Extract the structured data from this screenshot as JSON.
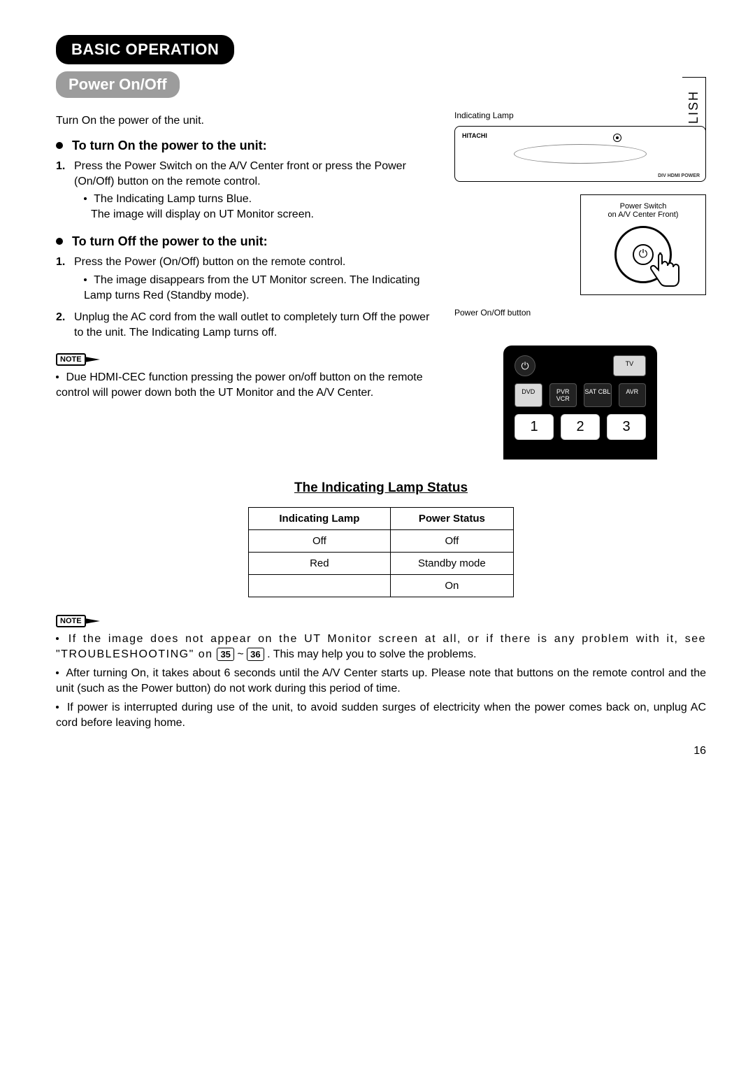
{
  "language_tab": "ENGLISH",
  "section_title": "BASIC OPERATION",
  "subsection_title": "Power On/Off",
  "intro": "Turn On the power of the unit.",
  "turn_on": {
    "heading": "To turn On the power to the unit:",
    "step1_num": "1.",
    "step1": "Press the Power Switch on the A/V Center front or press the Power (On/Off) button on the remote control.",
    "step1_sub_a": "The Indicating Lamp turns Blue.",
    "step1_sub_b": "The image will display on UT Monitor screen."
  },
  "turn_off": {
    "heading": "To turn Off the power to the unit:",
    "step1_num": "1.",
    "step1": "Press the Power (On/Off) button on the remote control.",
    "step1_sub": "The image disappears from the UT Monitor screen. The Indicating Lamp turns Red (Standby mode).",
    "step2_num": "2.",
    "step2": "Unplug the AC cord from the wall outlet to completely turn Off the power to the unit. The Indicating Lamp turns off."
  },
  "note1": {
    "tag": "NOTE",
    "text": "Due HDMI-CEC function pressing the power on/off button on the remote control will power down both the UT Monitor and the A/V Center."
  },
  "diagram": {
    "indicating_lamp_label": "Indicating Lamp",
    "brand": "HITACHI",
    "logos": "DIV  HDMI  POWER",
    "zoom_caption_1": "Power Switch",
    "zoom_caption_2": "on A/V Center Front)",
    "power_btn_label": "Power On/Off button",
    "remote": {
      "power_icon": "⏻",
      "tv": "TV",
      "dvd": "DVD",
      "pvr": "PVR VCR",
      "sat": "SAT CBL",
      "avr": "AVR",
      "n1": "1",
      "n2": "2",
      "n3": "3"
    }
  },
  "table": {
    "title": "The Indicating Lamp Status",
    "h1": "Indicating Lamp",
    "h2": "Power Status",
    "rows": [
      {
        "lamp": "Off",
        "status": "Off"
      },
      {
        "lamp": "Red",
        "status": "Standby mode"
      },
      {
        "lamp": "",
        "status": "On"
      }
    ]
  },
  "note2": {
    "tag": "NOTE",
    "b1a": "If the image does not appear on the UT Monitor screen at all, or if there is any problem with it, see \"TROUBLESHOOTING\" on ",
    "ref1": "35",
    "tilde": "~",
    "ref2": "36",
    "b1b": ". This may help you to solve the problems.",
    "b2": "After turning On, it takes about 6 seconds until the A/V Center starts up. Please note that buttons on the remote control and the unit (such as the Power button) do not work during this period of time.",
    "b3": "If power is interrupted during use of the unit, to avoid sudden surges of electricity when the power comes back on, unplug AC cord before leaving home."
  },
  "page_number": "16"
}
